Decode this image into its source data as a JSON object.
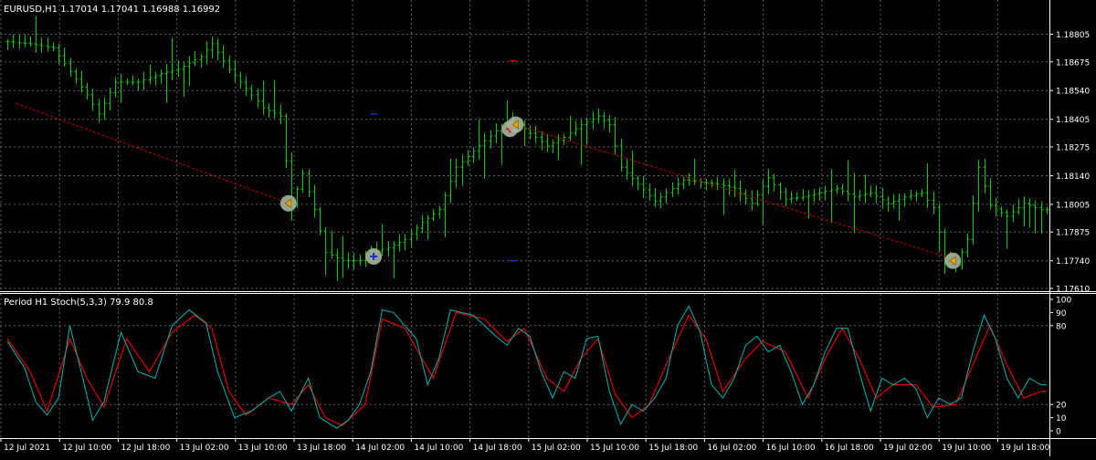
{
  "window": {
    "symbol_header": "EURUSD,H1  1.17014 1.17041 1.16988 1.16992",
    "indicator_header": "Period H1 Stoch(5,3,3) 79.9 80.8"
  },
  "colors": {
    "background": "#000000",
    "grid": "#5a6470",
    "bars": "#00cc00",
    "trendline": "#c00000",
    "stoch_main": "#00b4b4",
    "stoch_signal": "#e00000",
    "axis_text": "#ffffff",
    "marker_fill": "#a9b29b"
  },
  "chart_data": [
    {
      "type": "bar",
      "name": "price",
      "ylim": [
        1.1761,
        1.1888
      ],
      "yticks": [
        "1.18805",
        "1.18675",
        "1.18540",
        "1.18405",
        "1.18275",
        "1.18140",
        "1.18005",
        "1.17875",
        "1.17740",
        "1.17610"
      ],
      "xticks": [
        "12 Jul 2021",
        "12 Jul 10:00",
        "12 Jul 18:00",
        "13 Jul 02:00",
        "13 Jul 10:00",
        "13 Jul 18:00",
        "14 Jul 02:00",
        "14 Jul 10:00",
        "14 Jul 18:00",
        "15 Jul 02:00",
        "15 Jul 10:00",
        "15 Jul 18:00",
        "16 Jul 02:00",
        "16 Jul 10:00",
        "16 Jul 18:00",
        "19 Jul 02:00",
        "19 Jul 10:00",
        "19 Jul 18:00"
      ],
      "close_anchors": [
        [
          0,
          1.1877
        ],
        [
          4,
          1.1876
        ],
        [
          8,
          1.1874
        ],
        [
          11,
          1.1863
        ],
        [
          14,
          1.1852
        ],
        [
          16,
          1.1843
        ],
        [
          19,
          1.1858
        ],
        [
          23,
          1.1858
        ],
        [
          27,
          1.1862
        ],
        [
          30,
          1.1864
        ],
        [
          34,
          1.187
        ],
        [
          36,
          1.1876
        ],
        [
          39,
          1.1864
        ],
        [
          41,
          1.1858
        ],
        [
          45,
          1.1846
        ],
        [
          48,
          1.1842
        ],
        [
          50,
          1.18
        ],
        [
          52,
          1.1815
        ],
        [
          54,
          1.1798
        ],
        [
          56,
          1.1778
        ],
        [
          59,
          1.1774
        ],
        [
          62,
          1.1774
        ],
        [
          64,
          1.1778
        ],
        [
          67,
          1.178
        ],
        [
          70,
          1.1784
        ],
        [
          73,
          1.1792
        ],
        [
          76,
          1.1798
        ],
        [
          79,
          1.1818
        ],
        [
          83,
          1.1828
        ],
        [
          86,
          1.1835
        ],
        [
          89,
          1.184
        ],
        [
          92,
          1.1834
        ],
        [
          95,
          1.1828
        ],
        [
          98,
          1.1832
        ],
        [
          101,
          1.1838
        ],
        [
          104,
          1.1842
        ],
        [
          106,
          1.1838
        ],
        [
          108,
          1.1818
        ],
        [
          111,
          1.181
        ],
        [
          114,
          1.1802
        ],
        [
          116,
          1.1806
        ],
        [
          119,
          1.1812
        ],
        [
          122,
          1.1811
        ],
        [
          125,
          1.181
        ],
        [
          128,
          1.1808
        ],
        [
          131,
          1.1801
        ],
        [
          134,
          1.1813
        ],
        [
          137,
          1.1803
        ],
        [
          140,
          1.1804
        ],
        [
          143,
          1.1806
        ],
        [
          146,
          1.1808
        ],
        [
          149,
          1.1804
        ],
        [
          152,
          1.1806
        ],
        [
          155,
          1.1801
        ],
        [
          158,
          1.1804
        ],
        [
          161,
          1.1806
        ],
        [
          163,
          1.1799
        ],
        [
          165,
          1.1776
        ],
        [
          167,
          1.1772
        ],
        [
          169,
          1.1784
        ],
        [
          171,
          1.1818
        ],
        [
          173,
          1.18
        ],
        [
          176,
          1.1795
        ],
        [
          179,
          1.1801
        ],
        [
          182,
          1.1798
        ]
      ],
      "trend_segments": [
        [
          [
            1.5,
            1.1848
          ],
          [
            49.5,
            1.1801
          ]
        ],
        [
          [
            89.5,
            1.1838
          ],
          [
            166.5,
            1.1775
          ]
        ]
      ],
      "arrow_markers": [
        {
          "at": 49.5,
          "price": 1.1801,
          "kind": "sell-close"
        },
        {
          "at": 64.5,
          "price": 1.1776,
          "kind": "buy-open"
        },
        {
          "at": 88.5,
          "price": 1.1836,
          "kind": "buy-close"
        },
        {
          "at": 89.5,
          "price": 1.1838,
          "kind": "sell-open"
        },
        {
          "at": 166.5,
          "price": 1.1774,
          "kind": "sell-close"
        }
      ],
      "dash_markers": [
        {
          "at": 89,
          "price": 1.1868,
          "color": "#cc0000"
        },
        {
          "at": 64.5,
          "price": 1.1843,
          "color": "#1a2fd0"
        },
        {
          "at": 89,
          "price": 1.1774,
          "color": "#1a2fd0"
        }
      ]
    },
    {
      "type": "line",
      "name": "Stoch(5,3,3)",
      "ylim": [
        0,
        100
      ],
      "yticks": [
        "100",
        "90",
        "80",
        "20",
        "10",
        "0"
      ],
      "levels": [
        20,
        80
      ],
      "main_anchors": [
        [
          0,
          68
        ],
        [
          3,
          48
        ],
        [
          5,
          22
        ],
        [
          7,
          12
        ],
        [
          9,
          25
        ],
        [
          11,
          80
        ],
        [
          13,
          45
        ],
        [
          15,
          8
        ],
        [
          17,
          22
        ],
        [
          20,
          75
        ],
        [
          23,
          45
        ],
        [
          26,
          40
        ],
        [
          29,
          80
        ],
        [
          32,
          92
        ],
        [
          35,
          82
        ],
        [
          37,
          45
        ],
        [
          40,
          10
        ],
        [
          43,
          15
        ],
        [
          46,
          25
        ],
        [
          48,
          30
        ],
        [
          50,
          15
        ],
        [
          53,
          40
        ],
        [
          55,
          10
        ],
        [
          58,
          2
        ],
        [
          60,
          8
        ],
        [
          62,
          20
        ],
        [
          64,
          45
        ],
        [
          66,
          92
        ],
        [
          68,
          90
        ],
        [
          70,
          80
        ],
        [
          72,
          70
        ],
        [
          74,
          35
        ],
        [
          76,
          55
        ],
        [
          78,
          92
        ],
        [
          80,
          90
        ],
        [
          82,
          88
        ],
        [
          84,
          80
        ],
        [
          86,
          72
        ],
        [
          88,
          65
        ],
        [
          90,
          78
        ],
        [
          92,
          72
        ],
        [
          94,
          45
        ],
        [
          96,
          25
        ],
        [
          98,
          45
        ],
        [
          100,
          40
        ],
        [
          102,
          70
        ],
        [
          104,
          72
        ],
        [
          106,
          30
        ],
        [
          108,
          5
        ],
        [
          110,
          20
        ],
        [
          112,
          15
        ],
        [
          114,
          25
        ],
        [
          116,
          40
        ],
        [
          118,
          80
        ],
        [
          120,
          95
        ],
        [
          122,
          75
        ],
        [
          124,
          35
        ],
        [
          126,
          25
        ],
        [
          128,
          40
        ],
        [
          130,
          65
        ],
        [
          132,
          72
        ],
        [
          134,
          60
        ],
        [
          136,
          65
        ],
        [
          138,
          45
        ],
        [
          140,
          20
        ],
        [
          142,
          35
        ],
        [
          144,
          60
        ],
        [
          146,
          78
        ],
        [
          148,
          78
        ],
        [
          150,
          45
        ],
        [
          152,
          15
        ],
        [
          154,
          40
        ],
        [
          156,
          35
        ],
        [
          158,
          40
        ],
        [
          160,
          32
        ],
        [
          162,
          10
        ],
        [
          164,
          25
        ],
        [
          166,
          20
        ],
        [
          168,
          25
        ],
        [
          170,
          60
        ],
        [
          172,
          88
        ],
        [
          174,
          70
        ],
        [
          176,
          40
        ],
        [
          178,
          25
        ],
        [
          180,
          40
        ],
        [
          182,
          35
        ]
      ],
      "signal_anchors": [
        [
          0,
          70
        ],
        [
          4,
          45
        ],
        [
          7,
          15
        ],
        [
          11,
          70
        ],
        [
          14,
          40
        ],
        [
          17,
          18
        ],
        [
          21,
          70
        ],
        [
          25,
          45
        ],
        [
          29,
          75
        ],
        [
          33,
          88
        ],
        [
          36,
          78
        ],
        [
          39,
          30
        ],
        [
          42,
          12
        ],
        [
          46,
          25
        ],
        [
          50,
          20
        ],
        [
          53,
          35
        ],
        [
          56,
          10
        ],
        [
          59,
          4
        ],
        [
          63,
          20
        ],
        [
          66,
          85
        ],
        [
          70,
          78
        ],
        [
          73,
          55
        ],
        [
          75,
          40
        ],
        [
          79,
          90
        ],
        [
          84,
          85
        ],
        [
          88,
          68
        ],
        [
          91,
          78
        ],
        [
          95,
          40
        ],
        [
          98,
          30
        ],
        [
          101,
          55
        ],
        [
          104,
          70
        ],
        [
          107,
          28
        ],
        [
          110,
          10
        ],
        [
          113,
          20
        ],
        [
          117,
          60
        ],
        [
          120,
          88
        ],
        [
          123,
          70
        ],
        [
          126,
          30
        ],
        [
          130,
          55
        ],
        [
          133,
          68
        ],
        [
          137,
          60
        ],
        [
          141,
          25
        ],
        [
          144,
          55
        ],
        [
          147,
          78
        ],
        [
          150,
          55
        ],
        [
          153,
          25
        ],
        [
          156,
          35
        ],
        [
          160,
          35
        ],
        [
          163,
          18
        ],
        [
          167,
          20
        ],
        [
          170,
          50
        ],
        [
          173,
          80
        ],
        [
          176,
          50
        ],
        [
          179,
          25
        ],
        [
          182,
          30
        ]
      ]
    }
  ]
}
